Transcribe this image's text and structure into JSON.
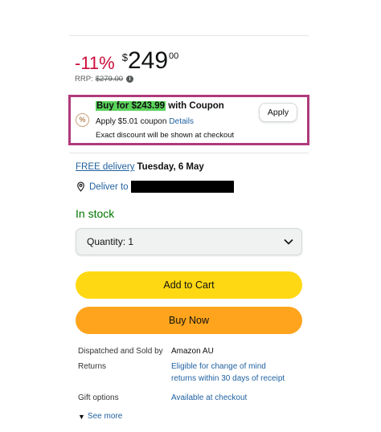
{
  "price": {
    "discount": "-11%",
    "currency": "$",
    "whole": "249",
    "fraction": "00",
    "rrp_label": "RRP:",
    "rrp_value": "$279.00"
  },
  "coupon": {
    "highlight_text": "Buy for $243.99",
    "suffix_text": " with Coupon",
    "apply_coupon_text": "Apply $5.01 coupon",
    "details_link": "Details",
    "note": "Exact discount will be shown at checkout",
    "apply_button": "Apply",
    "icon_glyph": "%",
    "border_color": "#b03a7c",
    "highlight_color": "#5bd45b"
  },
  "delivery": {
    "free_delivery": "FREE delivery",
    "date": "Tuesday, 6 May",
    "deliver_to": "Deliver to"
  },
  "stock": {
    "status": "In stock",
    "color": "#007600"
  },
  "quantity": {
    "label": "Quantity: 1"
  },
  "buttons": {
    "add_to_cart": "Add to Cart",
    "add_to_cart_color": "#ffd814",
    "buy_now": "Buy Now",
    "buy_now_color": "#ffa41c"
  },
  "info": {
    "dispatched_label": "Dispatched and Sold by",
    "dispatched_value": "Amazon AU",
    "returns_label": "Returns",
    "returns_line1": "Eligible for change of mind",
    "returns_line2": "returns within 30 days of receipt",
    "gift_label": "Gift options",
    "gift_value": "Available at checkout"
  },
  "see_more": "See more"
}
